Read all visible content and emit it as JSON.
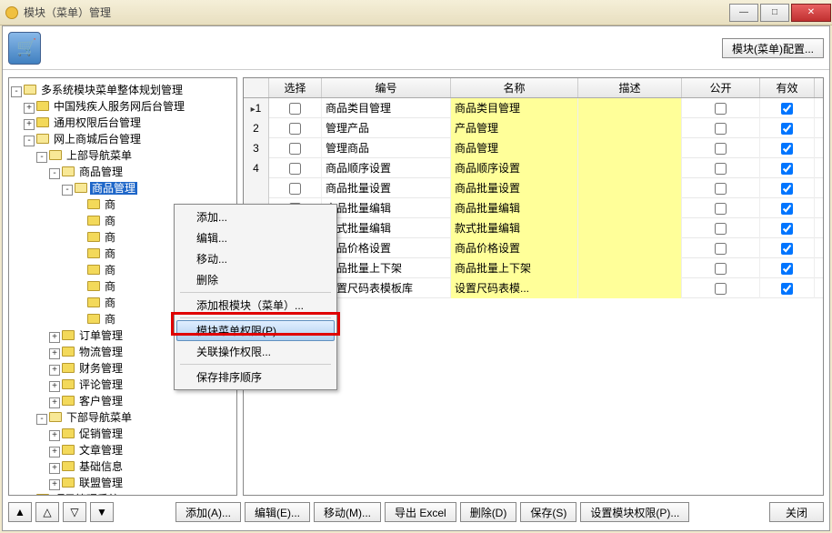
{
  "window": {
    "title": "模块（菜单）管理"
  },
  "top_button": {
    "config": "模块(菜单)配置..."
  },
  "tree": {
    "root": "多系统模块菜单整体规划管理",
    "n1": "中国残疾人服务网后台管理",
    "n2": "通用权限后台管理",
    "n3": "网上商城后台管理",
    "n3_1": "上部导航菜单",
    "n3_1_1": "商品管理",
    "n3_1_1_sel": "商品管理",
    "n3_1_1_a": "商",
    "n3_1_1_b": "商",
    "n3_1_1_c": "商",
    "n3_1_1_d": "商",
    "n3_1_1_e": "商",
    "n3_1_1_f": "商",
    "n3_1_1_g": "商",
    "n3_1_1_h": "商",
    "n3_1_2": "订单管理",
    "n3_1_3": "物流管理",
    "n3_1_4": "财务管理",
    "n3_1_5": "评论管理",
    "n3_1_6": "客户管理",
    "n3_2": "下部导航菜单",
    "n3_2_1": "促销管理",
    "n3_2_2": "文章管理",
    "n3_2_3": "基础信息",
    "n3_2_4": "联盟管理",
    "n4": "项目管理系统"
  },
  "grid": {
    "headers": {
      "select": "选择",
      "code": "编号",
      "name": "名称",
      "desc": "描述",
      "public": "公开",
      "valid": "有效"
    },
    "rows": [
      {
        "idx": "1",
        "sel": false,
        "code": "商品类目管理",
        "name": "商品类目管理",
        "desc": "",
        "pub": false,
        "valid": true,
        "current": true
      },
      {
        "idx": "2",
        "sel": false,
        "code": "管理产品",
        "name": "产品管理",
        "desc": "",
        "pub": false,
        "valid": true
      },
      {
        "idx": "3",
        "sel": false,
        "code": "管理商品",
        "name": "商品管理",
        "desc": "",
        "pub": false,
        "valid": true
      },
      {
        "idx": "4",
        "sel": false,
        "code": "商品顺序设置",
        "name": "商品顺序设置",
        "desc": "",
        "pub": false,
        "valid": true
      },
      {
        "idx": "",
        "sel": false,
        "code": "商品批量设置",
        "name": "商品批量设置",
        "desc": "",
        "pub": false,
        "valid": true
      },
      {
        "idx": "",
        "sel": false,
        "code": "商品批量编辑",
        "name": "商品批量编辑",
        "desc": "",
        "pub": false,
        "valid": true
      },
      {
        "idx": "",
        "sel": false,
        "code": "款式批量编辑",
        "name": "款式批量编辑",
        "desc": "",
        "pub": false,
        "valid": true
      },
      {
        "idx": "",
        "sel": false,
        "code": "商品价格设置",
        "name": "商品价格设置",
        "desc": "",
        "pub": false,
        "valid": true
      },
      {
        "idx": "",
        "sel": false,
        "code": "商品批量上下架",
        "name": "商品批量上下架",
        "desc": "",
        "pub": false,
        "valid": true
      },
      {
        "idx": "",
        "sel": false,
        "code": "设置尺码表模板库",
        "name": "设置尺码表模...",
        "desc": "",
        "pub": false,
        "valid": true
      }
    ]
  },
  "context_menu": {
    "add": "添加...",
    "edit": "编辑...",
    "move": "移动...",
    "delete": "删除",
    "add_root": "添加根模块（菜单）...",
    "perm": "模块菜单权限(P)...",
    "rel_perm": "关联操作权限...",
    "save_order": "保存排序顺序"
  },
  "bottom": {
    "add": "添加(A)...",
    "edit": "编辑(E)...",
    "move": "移动(M)...",
    "export": "导出 Excel",
    "delete": "删除(D)",
    "save": "保存(S)",
    "set_perm": "设置模块权限(P)...",
    "close": "关闭"
  }
}
